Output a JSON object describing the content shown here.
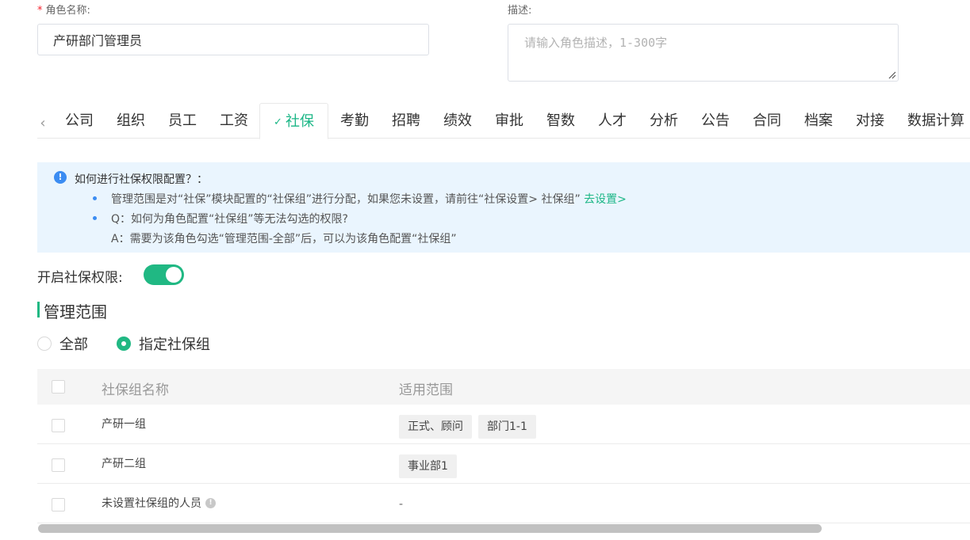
{
  "form": {
    "role_name_required_mark": "*",
    "role_name_label": "角色名称:",
    "role_name_value": "产研部门管理员",
    "description_label": "描述:",
    "description_placeholder": "请输入角色描述，1-300字"
  },
  "tabs": {
    "prev_glyph": "‹",
    "check_glyph": "✓",
    "items": [
      {
        "label": "公司"
      },
      {
        "label": "组织"
      },
      {
        "label": "员工"
      },
      {
        "label": "工资"
      },
      {
        "label": "社保"
      },
      {
        "label": "考勤"
      },
      {
        "label": "招聘"
      },
      {
        "label": "绩效"
      },
      {
        "label": "审批"
      },
      {
        "label": "智数"
      },
      {
        "label": "人才"
      },
      {
        "label": "分析"
      },
      {
        "label": "公告"
      },
      {
        "label": "合同"
      },
      {
        "label": "档案"
      },
      {
        "label": "对接"
      },
      {
        "label": "数据计算"
      }
    ],
    "active_index": 4
  },
  "info": {
    "icon_glyph": "!",
    "title": "如何进行社保权限配置？：",
    "line1": "管理范围是对“社保”模块配置的“社保组”进行分配，如果您未设置，请前往“社保设置> 社保组” ",
    "line1_link": "去设置>",
    "line2": "Q：如何为角色配置“社保组”等无法勾选的权限?",
    "line3": "A：需要为该角色勾选“管理范围-全部”后，可以为该角色配置“社保组”"
  },
  "permission": {
    "toggle_label": "开启社保权限:",
    "enabled": true
  },
  "scope": {
    "title": "管理范围",
    "options": [
      {
        "label": "全部",
        "checked": false
      },
      {
        "label": "指定社保组",
        "checked": true
      }
    ]
  },
  "table": {
    "headers": {
      "name": "社保组名称",
      "scope": "适用范围"
    },
    "rows": [
      {
        "name": "产研一组",
        "tags": [
          "正式、顾问",
          "部门1-1"
        ]
      },
      {
        "name": "产研二组",
        "tags": [
          "事业部1"
        ]
      },
      {
        "name": "未设置社保组的人员",
        "help_glyph": "!",
        "empty": "-"
      }
    ]
  },
  "colors": {
    "accent": "#20b883",
    "link": "#1bb686",
    "info_bg": "#eaf5fe",
    "info_icon": "#3b8cf2",
    "required": "#f5222d"
  }
}
